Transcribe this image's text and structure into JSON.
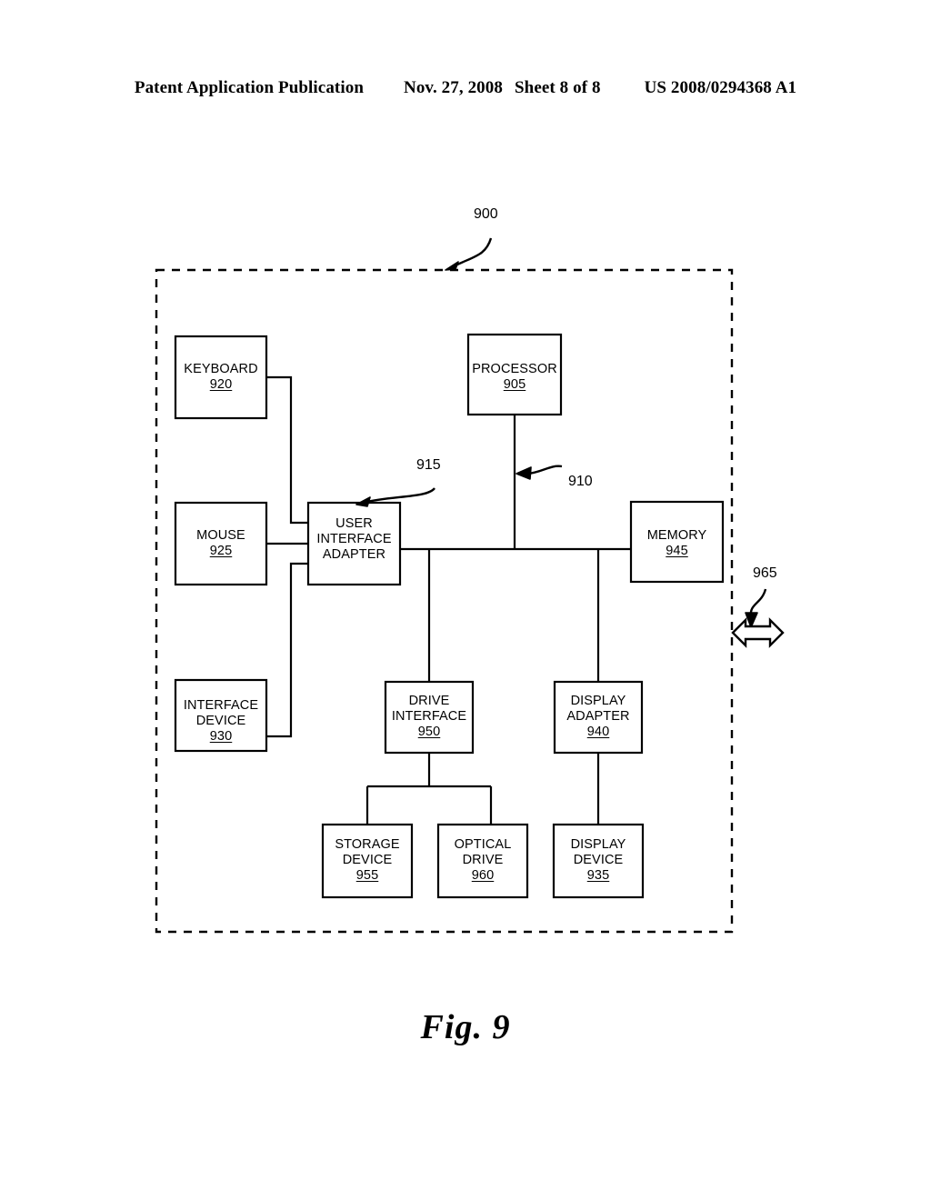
{
  "header": {
    "publication": "Patent Application Publication",
    "date": "Nov. 27, 2008",
    "sheet": "Sheet 8 of 8",
    "patent_number": "US 2008/0294368 A1"
  },
  "figure": {
    "caption": "Fig. 9",
    "system_ref": "900",
    "bus_ref": "910",
    "ui_adapter_ref": "915",
    "external_link_ref": "965"
  },
  "blocks": {
    "processor": {
      "line1": "PROCESSOR",
      "line2": "",
      "num": "905"
    },
    "keyboard": {
      "line1": "KEYBOARD",
      "line2": "",
      "num": "920"
    },
    "mouse": {
      "line1": "MOUSE",
      "line2": "",
      "num": "925"
    },
    "interface_device": {
      "line1": "INTERFACE",
      "line2": "DEVICE",
      "num": "930"
    },
    "ui_adapter": {
      "line1": "USER",
      "line2": "INTERFACE",
      "line3": "ADAPTER",
      "num": ""
    },
    "memory": {
      "line1": "MEMORY",
      "line2": "",
      "num": "945"
    },
    "drive_interface": {
      "line1": "DRIVE",
      "line2": "INTERFACE",
      "num": "950"
    },
    "display_adapter": {
      "line1": "DISPLAY",
      "line2": "ADAPTER",
      "num": "940"
    },
    "storage_device": {
      "line1": "STORAGE",
      "line2": "DEVICE",
      "num": "955"
    },
    "optical_drive": {
      "line1": "OPTICAL",
      "line2": "DRIVE",
      "num": "960"
    },
    "display_device": {
      "line1": "DISPLAY",
      "line2": "DEVICE",
      "num": "935"
    }
  },
  "colors": {
    "ink": "#000000",
    "paper": "#ffffff"
  }
}
